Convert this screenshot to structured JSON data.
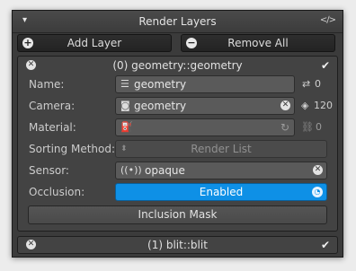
{
  "panel": {
    "title": "Render Layers",
    "collapse_glyph": "▾",
    "code_glyph": "<∕>"
  },
  "toolbar": {
    "add_label": "Add Layer",
    "remove_label": "Remove All"
  },
  "layers": [
    {
      "title": "(0) geometry::geometry",
      "fields": {
        "name_label": "Name:",
        "name_value": "geometry",
        "name_count": "0",
        "camera_label": "Camera:",
        "camera_value": "geometry",
        "camera_count": "120",
        "material_label": "Material:",
        "material_value": "",
        "material_count": "0",
        "sorting_label": "Sorting Method:",
        "sorting_value": "Render List",
        "sensor_label": "Sensor:",
        "sensor_value": "opaque",
        "occlusion_label": "Occlusion:",
        "occlusion_value": "Enabled",
        "inclusion_mask_label": "Inclusion Mask"
      }
    },
    {
      "title": "(1) blit::blit"
    }
  ],
  "colors": {
    "accent": "#0e90e6",
    "panel_bg": "#3b3b3b"
  },
  "icons": [
    "chevron-down-icon",
    "code-icon",
    "plus-circle-icon",
    "minus-circle-icon",
    "close-circle-icon",
    "check-icon",
    "layers-icon",
    "camera-icon",
    "cube-icon",
    "material-bucket-icon",
    "link-icon",
    "sensor-icon",
    "gauge-icon"
  ]
}
